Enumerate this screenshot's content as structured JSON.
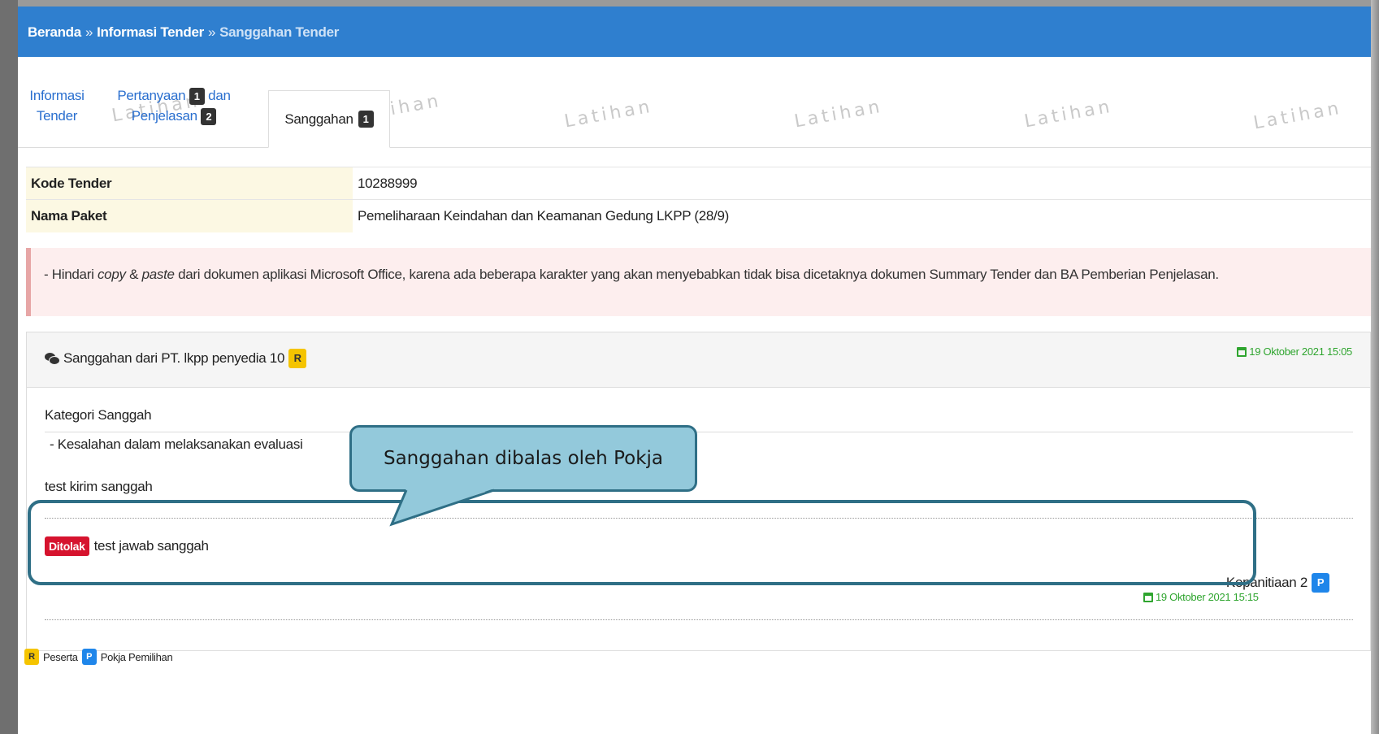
{
  "breadcrumb": {
    "home": "Beranda",
    "sep1": "»",
    "info": "Informasi Tender",
    "sep2": "»",
    "current": "Sanggahan Tender"
  },
  "watermark_text": "Latihan",
  "tabs": {
    "informasi_line1": "Informasi",
    "informasi_line2": "Tender",
    "pertanyaan_line1": "Pertanyaan",
    "pertanyaan_badge": "1",
    "pertanyaan_dan": "dan",
    "penjelasan_line2": "Penjelasan",
    "penjelasan_badge": "2",
    "sanggahan_label": "Sanggahan",
    "sanggahan_badge": "1"
  },
  "info": {
    "kode_label": "Kode Tender",
    "kode_value": "10288999",
    "nama_label": "Nama Paket",
    "nama_value": "Pemeliharaan Keindahan dan Keamanan Gedung LKPP (28/9)"
  },
  "alert": {
    "prefix": "- Hindari ",
    "copy": "copy",
    "amp": " & ",
    "paste": "paste",
    "rest": " dari dokumen aplikasi Microsoft Office, karena ada beberapa karakter yang akan menyebabkan tidak bisa dicetaknya dokumen Summary Tender dan BA Pemberian Penjelasan."
  },
  "sanggah": {
    "title": "Sanggahan dari PT. lkpp penyedia 10",
    "role_badge": "R",
    "date": "19 Oktober 2021 15:05",
    "kategori_label": "Kategori Sanggah",
    "kategori_item": "-  Kesalahan dalam melaksanakan evaluasi",
    "isi": "test kirim sanggah",
    "reply_status": "Ditolak",
    "reply_text": "test jawab sanggah",
    "reply_author": "Kepanitiaan 2",
    "reply_badge": "P",
    "reply_date": "19 Oktober 2021 15:15"
  },
  "legend": {
    "r_badge": "R",
    "r_label": "Peserta",
    "p_badge": "P",
    "p_label": "Pokja Pemilihan"
  },
  "callout": {
    "text": "Sanggahan dibalas oleh Pokja"
  },
  "colors": {
    "topbar": "#2f7fcf",
    "link": "#2a6fcf",
    "badge_r": "#f5c400",
    "badge_p": "#1f86ea",
    "badge_ditolak": "#d6132e",
    "date_green": "#2fa52f",
    "callout_fill": "#93c9db",
    "callout_border": "#2f6f86"
  }
}
